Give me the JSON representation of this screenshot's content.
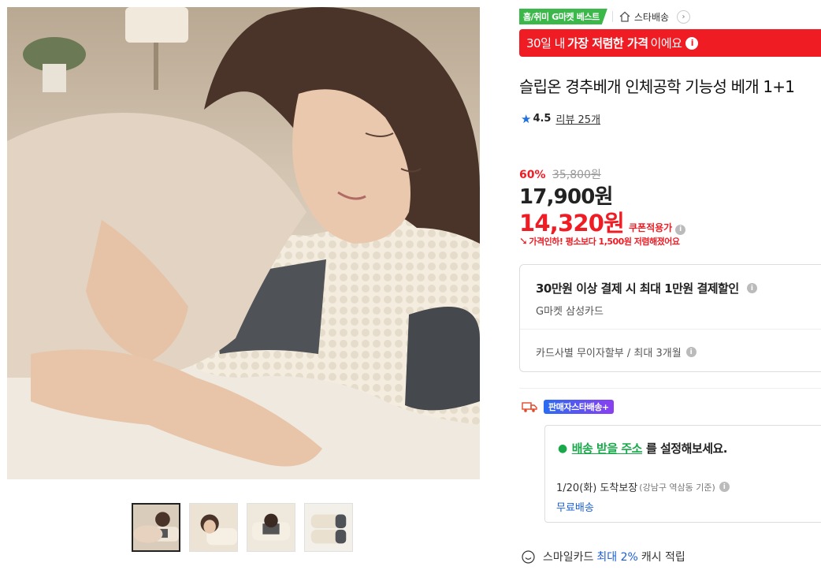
{
  "gallery": {
    "thumbnails": [
      {
        "name": "thumb-1",
        "active": true
      },
      {
        "name": "thumb-2",
        "active": false
      },
      {
        "name": "thumb-3",
        "active": false
      },
      {
        "name": "thumb-4",
        "active": false
      }
    ]
  },
  "badges": {
    "best": "홈/취미 G마켓 베스트",
    "star_delivery": "스타배송"
  },
  "banner": {
    "prefix": "30일 내",
    "highlight": "가장 저렴한 가격",
    "suffix": "이에요"
  },
  "product": {
    "title": "슬립온 경추베개 인체공학 기능성 베개 1+1",
    "rating": "4.5",
    "review_label": "리뷰 25개"
  },
  "price": {
    "discount_rate": "60%",
    "original": "35,800원",
    "sale": "17,900원",
    "coupon": "14,320원",
    "coupon_label": "쿠폰적용가",
    "drop_notice": "가격인하! 평소보다 1,500원 저렴해졌어요"
  },
  "card_benefit": {
    "headline": "30만원 이상 결제 시 최대 1만원 결제할인",
    "card_name": "G마켓 삼성카드",
    "installment": "카드사별 무이자할부 / 최대 3개월"
  },
  "shipping": {
    "seller_badge": "판매자스타배송+",
    "address_link": "배송 받을 주소",
    "address_rest": "를 설정해보세요.",
    "eta": "1/20(화) 도착보장",
    "eta_basis": "(강남구 역삼동 기준)",
    "fee": "무료배송"
  },
  "cashback": {
    "prefix": "스마일카드",
    "highlight": "최대 2%",
    "suffix": "캐시 적립"
  },
  "colors": {
    "accent_red": "#ef1c24",
    "best_green": "#3cb84b",
    "link_green": "#19a84a",
    "link_blue": "#1b5fd6",
    "star_blue": "#1e6fe0"
  }
}
